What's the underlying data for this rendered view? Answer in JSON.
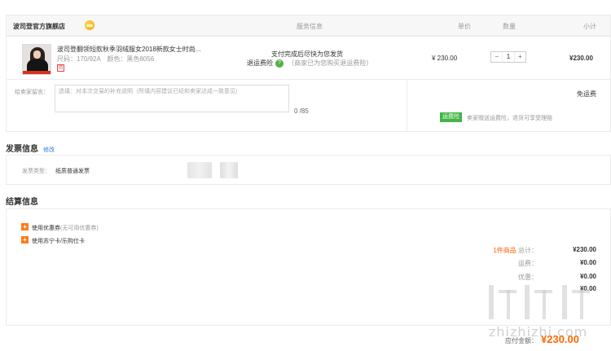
{
  "table_header": {
    "shop_name": "波司登官方旗舰店",
    "service_col": "服务信息",
    "price_col": "单价",
    "qty_col": "数量",
    "subtotal_col": "小计"
  },
  "product": {
    "title": "波司登翻领短款秋季羽绒服女2018新款女士时尚...",
    "spec": "尺码：170/92A　颜色：黑色8056",
    "badge": "团",
    "service_line1": "支付完成后尽快为您发货",
    "service_label": "退运费险",
    "service_help": "?",
    "service_note": "（商家已为您购买退运费险）",
    "price": "¥ 230.00",
    "qty_minus": "−",
    "qty": "1",
    "qty_plus": "+",
    "subtotal": "¥230.00"
  },
  "message": {
    "label": "给卖家留言：",
    "placeholder": "选填：对本次交易的补充说明（所填内容建议已经和卖家达成一致意见）",
    "counter": "0 /85"
  },
  "shipping": {
    "free": "免运费",
    "tag": "运费险",
    "note": "卖家赠送运费险，退货可享受理赔"
  },
  "invoice": {
    "title": "发票信息",
    "edit": "修改",
    "type_label": "发票类型：",
    "type_value": "纸质普通发票"
  },
  "settlement": {
    "title": "结算信息",
    "coupon_label": "使用优惠券",
    "coupon_note": "(无可用优惠券)",
    "card_label": "使用苏宁卡/乐购仕卡",
    "items_prefix": "1件商品",
    "items_suffix": "总计：",
    "items_total": "¥230.00",
    "shipping_label": "运费：",
    "shipping_value": "¥0.00",
    "discount_label": "优惠：",
    "discount_value": "¥0.00",
    "extra_value": "¥0.00",
    "pay_label": "应付金额：",
    "pay_value": "¥230.00"
  },
  "watermark": {
    "text": "zhizhizhi.com"
  },
  "colors": {
    "accent": "#ff6600",
    "link": "#2b7bd6",
    "green": "#44b549"
  }
}
